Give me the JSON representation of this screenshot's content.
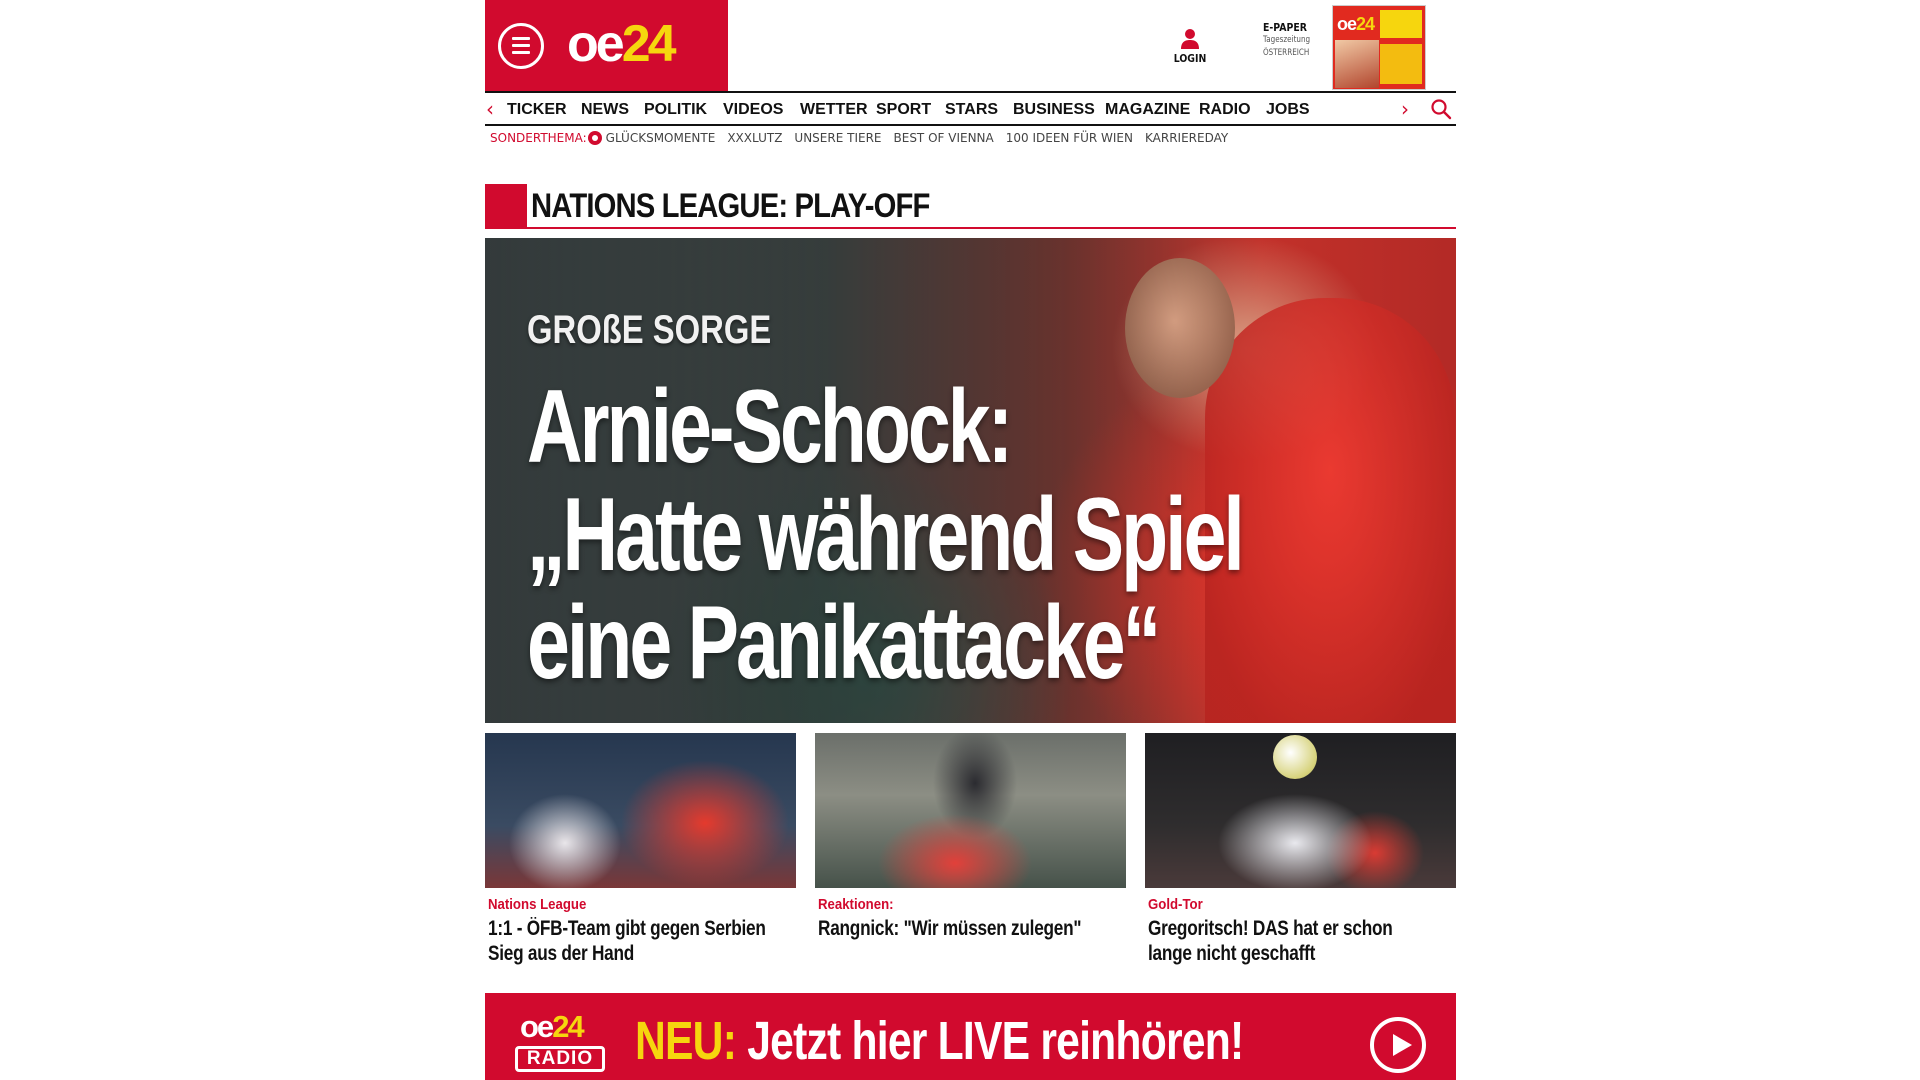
{
  "header": {
    "logo_oe": "oe",
    "logo_24": "24",
    "login_label": "LOGIN",
    "epaper_title": "E-PAPER",
    "epaper_sub1": "Tageszeitung",
    "epaper_sub2": "ÖSTERREICH"
  },
  "nav": {
    "prev_arrow": "‹",
    "next_arrow": "›",
    "items": [
      {
        "label": "TICKER"
      },
      {
        "label": "NEWS"
      },
      {
        "label": "POLITIK"
      },
      {
        "label": "VIDEOS"
      },
      {
        "label": "WETTER"
      },
      {
        "label": "SPORT"
      },
      {
        "label": "STARS"
      },
      {
        "label": "BUSINESS"
      },
      {
        "label": "MAGAZINE"
      },
      {
        "label": "RADIO"
      },
      {
        "label": "JOBS"
      }
    ]
  },
  "subnav": {
    "label": "SONDERTHEMA:",
    "items": [
      {
        "label": "GLÜCKSMOMENTE"
      },
      {
        "label": "XXXLUTZ"
      },
      {
        "label": "UNSERE TIERE"
      },
      {
        "label": "BEST OF VIENNA"
      },
      {
        "label": "100 IDEEN FÜR WIEN"
      },
      {
        "label": "KARRIEREDAY"
      }
    ]
  },
  "section": {
    "title": "NATIONS LEAGUE: PLAY-OFF"
  },
  "hero": {
    "kicker": "GROßE SORGE",
    "headline_line1": "Arnie-Schock:",
    "headline_line2": "„Hatte während Spiel",
    "headline_line3": "eine Panikattacke“"
  },
  "teasers": [
    {
      "kicker": "Nations League",
      "title": "1:1 - ÖFB-Team gibt gegen Serbien Sieg aus der Hand"
    },
    {
      "kicker": "Reaktionen:",
      "title": "Rangnick: \"Wir müssen zulegen\""
    },
    {
      "kicker": "Gold-Tor",
      "title": "Gregoritsch! DAS hat er schon lange nicht geschafft"
    }
  ],
  "radio": {
    "logo_oe": "oe",
    "logo_24": "24",
    "logo_label": "RADIO",
    "neu": "NEU:",
    "text": "Jetzt hier LIVE reinhören!"
  },
  "colors": {
    "brand_red": "#d10a2e",
    "brand_yellow": "#f6d60e"
  },
  "icons": {
    "menu": "hamburger-menu-icon",
    "login": "user-icon",
    "search": "search-icon",
    "play": "play-icon"
  }
}
